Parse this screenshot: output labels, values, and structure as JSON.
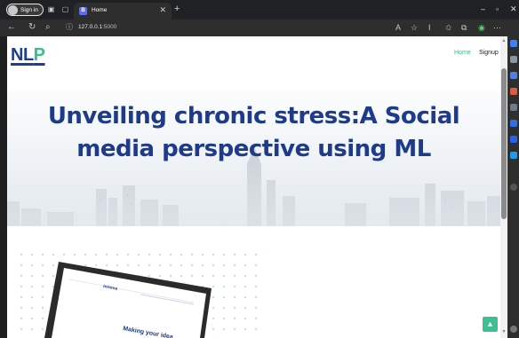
{
  "browser": {
    "profile_label": "Sign in",
    "tab_title": "Home",
    "tab_favicon": "B",
    "url_host": "127.0.0.1",
    "url_port": ":5000",
    "window_controls": [
      "–",
      "▫",
      "✕"
    ]
  },
  "page": {
    "logo_main": "NL",
    "logo_accent": "P",
    "nav": {
      "home": "Home",
      "signup": "Signup"
    },
    "hero_title": "Unveiling chronic stress:A Social media perspective using ML",
    "laptop_brand": "Innova",
    "laptop_tagline": "Making your idea"
  },
  "colors": {
    "brand_blue": "#1e3a8a",
    "accent_green": "#36c08e"
  },
  "icons": {
    "tab_actions": "workspaces-icon",
    "scroll_top": "chevron-up-icon"
  }
}
